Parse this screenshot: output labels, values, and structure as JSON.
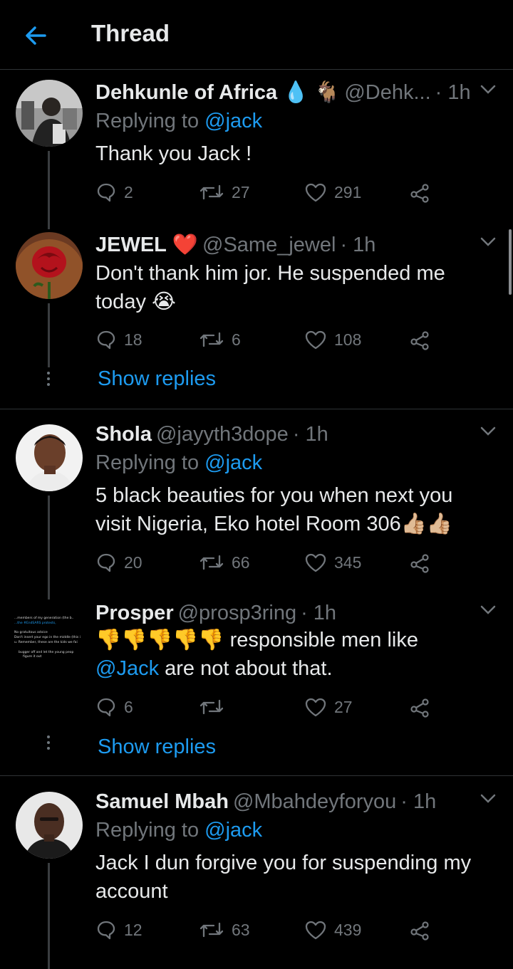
{
  "header": {
    "title": "Thread"
  },
  "tweets": [
    {
      "name": "Dehkunle of Africa",
      "emoji_1": "💧",
      "emoji_2": "🐐",
      "handle": "@Dehk...",
      "time": "· 1h",
      "replying_label": "Replying to",
      "replying_to": "@jack",
      "text": "Thank you Jack !",
      "replies": "2",
      "retweets": "27",
      "likes": "291"
    },
    {
      "name": "JEWEL",
      "emoji_1": "❤️",
      "handle": "@Same_jewel",
      "time": "· 1h",
      "text_line1": "Don't thank him jor. He suspended me",
      "text_line2": "today 😭",
      "replies": "18",
      "retweets": "6",
      "likes": "108",
      "show_replies": "Show replies"
    },
    {
      "name": "Shola",
      "handle": "@jayyth3dope",
      "time": "· 1h",
      "replying_label": "Replying to",
      "replying_to": "@jack",
      "text_line1": "5 black beauties for you when next you",
      "text_line2": "visit Nigeria, Eko hotel Room 306👍🏼👍🏼",
      "replies": "20",
      "retweets": "66",
      "likes": "345"
    },
    {
      "name": "Prosper",
      "handle": "@prosp3ring",
      "time": "· 1h",
      "text_line1": "👎👎👎👎👎 responsible men like",
      "mention": "@Jack",
      "text_line2_rest": " are not about that.",
      "replies": "6",
      "retweets": "",
      "likes": "27",
      "show_replies": "Show replies",
      "avatar_text": [
        "...members of my generation (the b..",
        "...the #EndSARS protests,",
        "No gratuitous advice",
        "Don't insert your ego in the middle (this i",
        "u. Remember, these are the kids we fai",
        "bugger off and let the young peop",
        "figure it out"
      ]
    },
    {
      "name": "Samuel Mbah",
      "handle": "@Mbahdeyforyou",
      "time": "· 1h",
      "replying_label": "Replying to",
      "replying_to": "@jack",
      "text_line1": "Jack I dun forgive you for suspending my",
      "text_line2": "account",
      "replies": "12",
      "retweets": "63",
      "likes": "439"
    }
  ],
  "colors": {
    "background": "#000000",
    "accent": "#1d9bf0",
    "muted": "#71767b",
    "text": "#e7e9ea",
    "heart": "#f91880"
  }
}
